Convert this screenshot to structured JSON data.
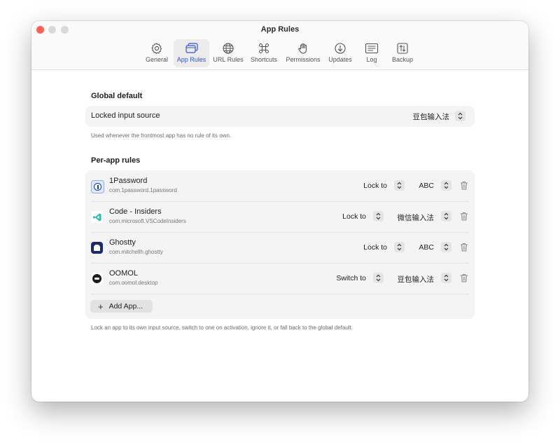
{
  "window": {
    "title": "App Rules"
  },
  "toolbar": {
    "items": [
      {
        "label": "General",
        "icon": "gear-icon"
      },
      {
        "label": "App Rules",
        "icon": "app-windows-icon"
      },
      {
        "label": "URL Rules",
        "icon": "globe-icon"
      },
      {
        "label": "Shortcuts",
        "icon": "command-icon"
      },
      {
        "label": "Permissions",
        "icon": "hand-icon"
      },
      {
        "label": "Updates",
        "icon": "download-circle-icon"
      },
      {
        "label": "Log",
        "icon": "log-list-icon"
      },
      {
        "label": "Backup",
        "icon": "backup-icon"
      }
    ],
    "active": "App Rules",
    "accent": "#2d57d8"
  },
  "global_default": {
    "heading": "Global default",
    "label": "Locked input source",
    "value": "豆包输入法",
    "caption": "Used whenever the frontmost app has no rule of its own."
  },
  "per_app": {
    "heading": "Per-app rules",
    "rules": [
      {
        "name": "1Password",
        "bundle_id": "com.1password.1password",
        "mode": "Lock to",
        "source": "ABC",
        "icon": "1password-icon"
      },
      {
        "name": "Code - Insiders",
        "bundle_id": "com.microsoft.VSCodeInsiders",
        "mode": "Lock to",
        "source": "微信输入法",
        "icon": "vscode-insiders-icon"
      },
      {
        "name": "Ghostty",
        "bundle_id": "com.mitchellh.ghostty",
        "mode": "Lock to",
        "source": "ABC",
        "icon": "ghostty-icon"
      },
      {
        "name": "OOMOL",
        "bundle_id": "com.oomol.desktop",
        "mode": "Switch to",
        "source": "豆包输入法",
        "icon": "oomol-icon"
      }
    ],
    "add_button": "Add App...",
    "caption": "Lock an app to its own input source, switch to one on activation, ignore it, or fall back to the global default."
  }
}
